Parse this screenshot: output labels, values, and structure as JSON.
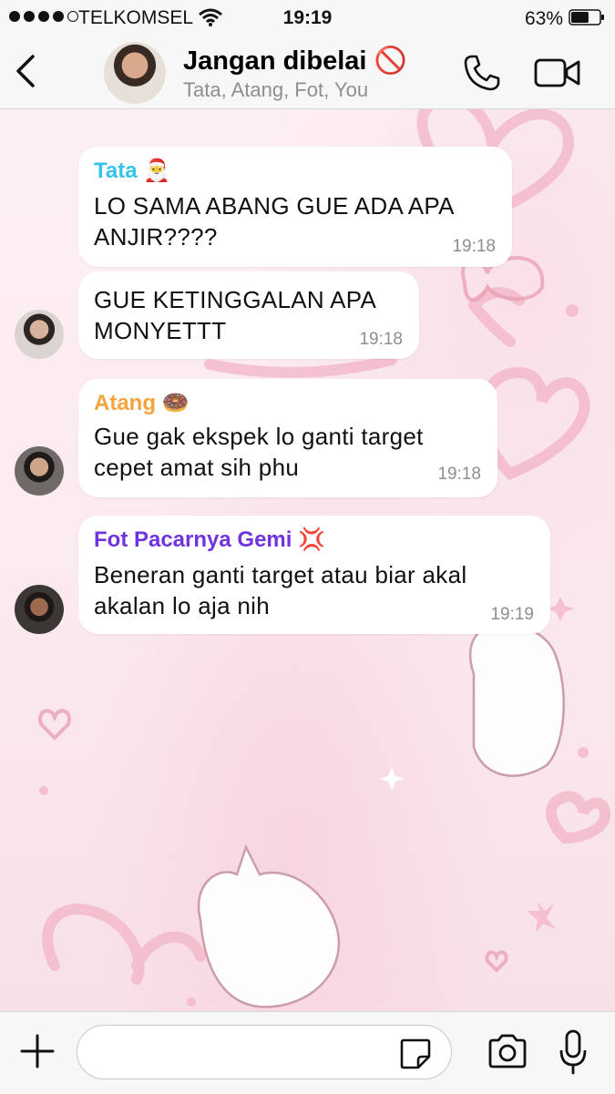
{
  "status_bar": {
    "carrier": "TELKOMSEL",
    "time": "19:19",
    "battery_percent": "63%",
    "battery_level": 0.63
  },
  "header": {
    "title": "Jangan dibelai 🚫",
    "members": "Tata, Atang, Fot, You",
    "icons": {
      "back": "chevron-left-icon",
      "call": "phone-icon",
      "video": "video-camera-icon"
    }
  },
  "colors": {
    "tata": "#35c3ea",
    "atang": "#f3a43c",
    "fot": "#6f34e0",
    "bubble": "#ffffff",
    "time": "#8e8e93",
    "wallpaper_accent": "#f4b6c8"
  },
  "messages": [
    {
      "sender": "Tata 🎅",
      "text_lines": [
        "LO SAMA ABANG GUE ADA APA",
        "ANJIR????"
      ],
      "time": "19:18"
    },
    {
      "sender": "",
      "text_lines": [
        "GUE KETINGGALAN APA",
        "MONYETTT"
      ],
      "time": "19:18"
    },
    {
      "sender": "Atang 🍩",
      "text_lines": [
        "Gue gak ekspek lo ganti target",
        "cepet amat sih phu"
      ],
      "time": "19:18"
    },
    {
      "sender": "Fot Pacarnya Gemi 💢",
      "text_lines": [
        "Beneran ganti target atau biar akal",
        "akalan lo aja nih"
      ],
      "time": "19:19"
    }
  ],
  "input_bar": {
    "placeholder": "",
    "icons": {
      "add": "plus-icon",
      "sticker": "sticker-icon",
      "camera": "camera-icon",
      "mic": "microphone-icon"
    }
  }
}
